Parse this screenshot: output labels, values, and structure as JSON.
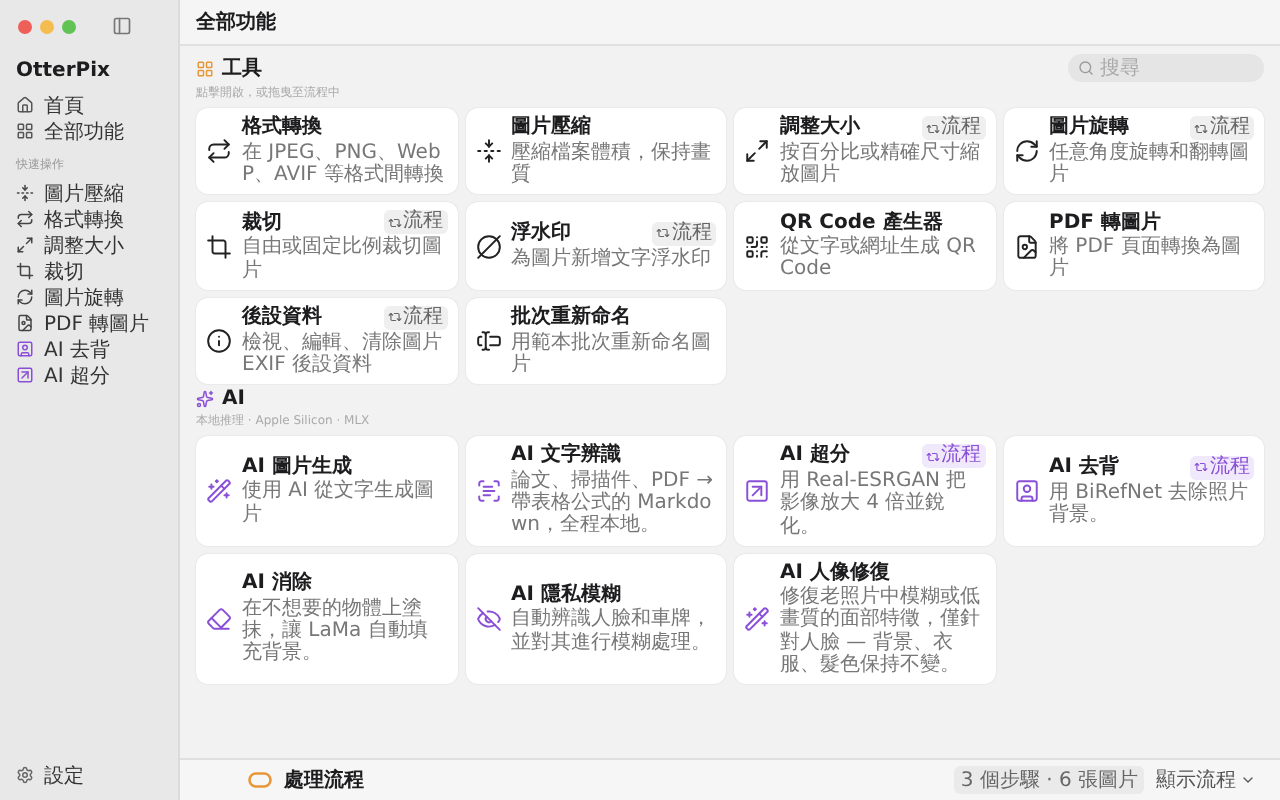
{
  "window": {
    "title": "全部功能"
  },
  "sidebar": {
    "app_name": "OtterPix",
    "nav": [
      {
        "label": "首頁"
      },
      {
        "label": "全部功能"
      }
    ],
    "quick_title": "快速操作",
    "quick": [
      {
        "label": "圖片壓縮",
        "kind": "tool"
      },
      {
        "label": "格式轉換",
        "kind": "tool"
      },
      {
        "label": "調整大小",
        "kind": "tool"
      },
      {
        "label": "裁切",
        "kind": "tool"
      },
      {
        "label": "圖片旋轉",
        "kind": "tool"
      },
      {
        "label": "PDF 轉圖片",
        "kind": "tool"
      },
      {
        "label": "AI 去背",
        "kind": "ai"
      },
      {
        "label": "AI 超分",
        "kind": "ai"
      }
    ],
    "settings": "設定"
  },
  "search": {
    "placeholder": "搜尋"
  },
  "sections": [
    {
      "kind": "tools",
      "title": "工具",
      "subtitle": "點擊開啟，或拖曳至流程中",
      "cards": [
        {
          "title": "格式轉換",
          "desc": "在 JPEG、PNG、WebP、AVIF 等格式間轉換"
        },
        {
          "title": "圖片壓縮",
          "desc": "壓縮檔案體積，保持畫質"
        },
        {
          "title": "調整大小",
          "desc": "按百分比或精確尺寸縮放圖片",
          "badge": "流程"
        },
        {
          "title": "圖片旋轉",
          "desc": "任意角度旋轉和翻轉圖片",
          "badge": "流程"
        },
        {
          "title": "裁切",
          "desc": "自由或固定比例裁切圖片",
          "badge": "流程"
        },
        {
          "title": "浮水印",
          "desc": "為圖片新增文字浮水印",
          "badge": "流程"
        },
        {
          "title": "QR Code 產生器",
          "desc": "從文字或網址生成 QR Code"
        },
        {
          "title": "PDF 轉圖片",
          "desc": "將 PDF 頁面轉換為圖片"
        },
        {
          "title": "後設資料",
          "desc": "檢視、編輯、清除圖片 EXIF 後設資料",
          "badge": "流程"
        },
        {
          "title": "批次重新命名",
          "desc": "用範本批次重新命名圖片"
        }
      ]
    },
    {
      "kind": "ai",
      "title": "AI",
      "subtitle": "本地推理 · Apple Silicon · MLX",
      "cards": [
        {
          "title": "AI 圖片生成",
          "desc": "使用 AI 從文字生成圖片"
        },
        {
          "title": "AI 文字辨識",
          "desc": "論文、掃描件、PDF → 帶表格公式的 Markdown，全程本地。"
        },
        {
          "title": "AI 超分",
          "desc": "用 Real-ESRGAN 把影像放大 4 倍並銳化。",
          "badge": "流程"
        },
        {
          "title": "AI 去背",
          "desc": "用 BiRefNet 去除照片背景。",
          "badge": "流程"
        },
        {
          "title": "AI 消除",
          "desc": "在不想要的物體上塗抹，讓 LaMa 自動填充背景。"
        },
        {
          "title": "AI 隱私模糊",
          "desc": "自動辨識人臉和車牌，並對其進行模糊處理。"
        },
        {
          "title": "AI 人像修復",
          "desc": "修復老照片中模糊或低畫質的面部特徵，僅針對人臉 — 背景、衣服、髮色保持不變。"
        }
      ]
    }
  ],
  "pipeline": {
    "title": "處理流程",
    "summary": "3 個步驟 · 6 張圖片",
    "toggle": "顯示流程"
  }
}
